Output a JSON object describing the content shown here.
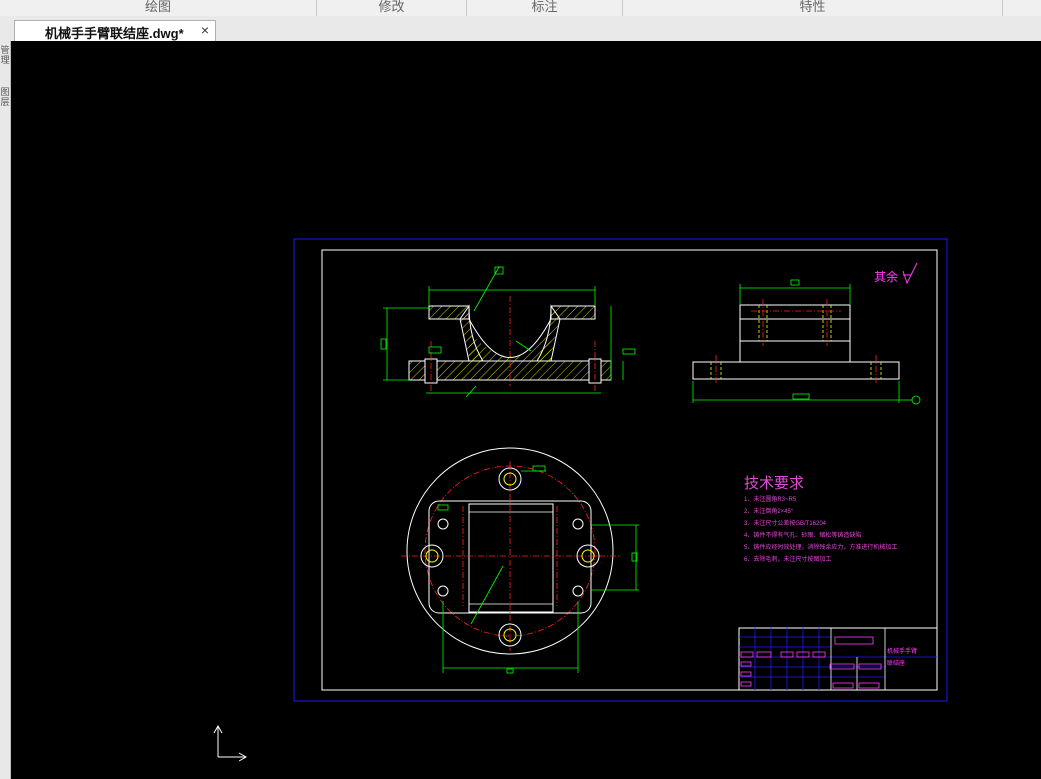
{
  "ribbon": {
    "groups": [
      "绘图",
      "修改",
      "标注",
      "特性"
    ]
  },
  "document_tab": {
    "title": "机械手手臂联结座.dwg*",
    "close_glyph": "×"
  },
  "left_palette": {
    "labels": [
      "管理",
      "图层"
    ]
  },
  "drawing": {
    "roughness_label": "其余",
    "tech_requirements": {
      "title": "技术要求",
      "items": [
        "1、未注圆角R3~R5",
        "2、未注倒角2×45°",
        "3、未注尺寸公差按GB/T16204",
        "4、铸件不得有气孔、砂眼、缩松等铸造缺陷",
        "5、铸件应经时效处理，消除残余应力，方准进行机械加工",
        "6、去除毛刺，未注尺寸按图加工"
      ]
    },
    "title_block": {
      "part_name_line1": "机械手手臂",
      "part_name_line2": "联结座"
    }
  },
  "colors": {
    "border_blue": "#1a1aff",
    "frame_white": "#ffffff",
    "geometry_yellow": "#ffff00",
    "dimension_green": "#00ff00",
    "center_red": "#ff2020",
    "text_magenta": "#e04ad8"
  },
  "icons": {
    "ucs": "ucs-axis-icon",
    "close": "close-icon"
  }
}
